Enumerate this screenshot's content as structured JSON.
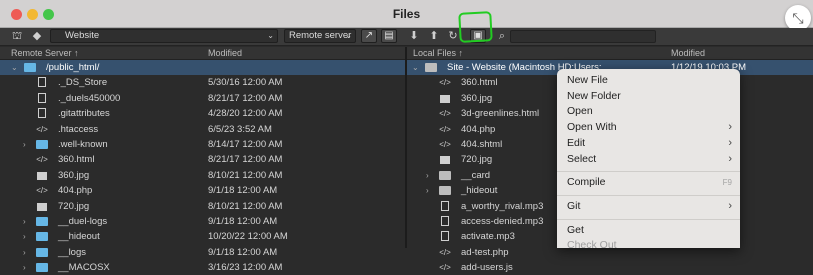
{
  "window": {
    "title": "Files"
  },
  "toolbar": {
    "site_select": "Website",
    "server_select": "Remote server"
  },
  "remote": {
    "header_name": "Remote Server ↑",
    "header_modified": "Modified",
    "rows": [
      {
        "name": "/public_html/",
        "date": "",
        "icon": "folder",
        "indent": 0,
        "twisty": "⌄",
        "selected": true
      },
      {
        "name": "._DS_Store",
        "date": "5/30/16 12:00 AM",
        "icon": "page",
        "indent": 1,
        "twisty": ""
      },
      {
        "name": "._duels450000",
        "date": "8/21/17 12:00 AM",
        "icon": "page",
        "indent": 1,
        "twisty": ""
      },
      {
        "name": ".gitattributes",
        "date": "4/28/20 12:00 AM",
        "icon": "page",
        "indent": 1,
        "twisty": ""
      },
      {
        "name": ".htaccess",
        "date": "6/5/23 3:52 AM",
        "icon": "code",
        "indent": 1,
        "twisty": ""
      },
      {
        "name": ".well-known",
        "date": "8/14/17 12:00 AM",
        "icon": "folder",
        "indent": 1,
        "twisty": "›"
      },
      {
        "name": "360.html",
        "date": "8/21/17 12:00 AM",
        "icon": "code",
        "indent": 1,
        "twisty": ""
      },
      {
        "name": "360.jpg",
        "date": "8/10/21 12:00 AM",
        "icon": "image",
        "indent": 1,
        "twisty": ""
      },
      {
        "name": "404.php",
        "date": "9/1/18 12:00 AM",
        "icon": "code",
        "indent": 1,
        "twisty": ""
      },
      {
        "name": "720.jpg",
        "date": "8/10/21 12:00 AM",
        "icon": "image",
        "indent": 1,
        "twisty": ""
      },
      {
        "name": "__duel-logs",
        "date": "9/1/18 12:00 AM",
        "icon": "folder",
        "indent": 1,
        "twisty": "›"
      },
      {
        "name": "__hideout",
        "date": "10/20/22 12:00 AM",
        "icon": "folder",
        "indent": 1,
        "twisty": "›"
      },
      {
        "name": "__logs",
        "date": "9/1/18 12:00 AM",
        "icon": "folder",
        "indent": 1,
        "twisty": "›"
      },
      {
        "name": "__MACOSX",
        "date": "3/16/23 12:00 AM",
        "icon": "folder",
        "indent": 1,
        "twisty": "›"
      }
    ]
  },
  "local": {
    "header_name": "Local Files ↑",
    "header_modified": "Modified",
    "rows": [
      {
        "name": "Site - Website (Macintosh HD:Users:...",
        "date": "1/12/19 10:03 PM",
        "icon": "folder-grey",
        "indent": 0,
        "twisty": "⌄",
        "selected": true
      },
      {
        "name": "360.html",
        "icon": "code",
        "indent": 1,
        "twisty": ""
      },
      {
        "name": "360.jpg",
        "icon": "image",
        "indent": 1,
        "twisty": ""
      },
      {
        "name": "3d-greenlines.html",
        "icon": "code",
        "indent": 1,
        "twisty": ""
      },
      {
        "name": "404.php",
        "icon": "code",
        "indent": 1,
        "twisty": ""
      },
      {
        "name": "404.shtml",
        "icon": "code",
        "indent": 1,
        "twisty": ""
      },
      {
        "name": "720.jpg",
        "icon": "image",
        "indent": 1,
        "twisty": ""
      },
      {
        "name": "__card",
        "icon": "folder-grey",
        "indent": 1,
        "twisty": "›"
      },
      {
        "name": "_hideout",
        "icon": "folder-grey",
        "indent": 1,
        "twisty": "›"
      },
      {
        "name": "a_worthy_rival.mp3",
        "icon": "page",
        "indent": 1,
        "twisty": ""
      },
      {
        "name": "access-denied.mp3",
        "icon": "page",
        "indent": 1,
        "twisty": ""
      },
      {
        "name": "activate.mp3",
        "icon": "page",
        "indent": 1,
        "twisty": ""
      },
      {
        "name": "ad-test.php",
        "icon": "code",
        "indent": 1,
        "twisty": ""
      },
      {
        "name": "add-users.js",
        "icon": "code",
        "indent": 1,
        "twisty": ""
      }
    ]
  },
  "context_menu": {
    "items": [
      {
        "label": "New File",
        "arrow": false
      },
      {
        "label": "New Folder",
        "arrow": false
      },
      {
        "label": "Open",
        "arrow": false
      },
      {
        "label": "Open With",
        "arrow": true
      },
      {
        "label": "Edit",
        "arrow": true
      },
      {
        "label": "Select",
        "arrow": true
      },
      {
        "label": "Compile",
        "shortcut": "F9",
        "sep_before": true
      },
      {
        "label": "Git",
        "arrow": true,
        "sep_before": true
      },
      {
        "label": "Get",
        "sep_before": true
      },
      {
        "label": "Check Out",
        "disabled": true
      }
    ]
  },
  "colors": {
    "accent": "#36516e",
    "folder": "#66b7e6",
    "annotation": "#22cc22"
  },
  "icons": [
    "site-icon",
    "connect-icon",
    "refresh-icon",
    "get-icon",
    "put-icon",
    "sync-icon",
    "expand-icon",
    "search-icon"
  ]
}
